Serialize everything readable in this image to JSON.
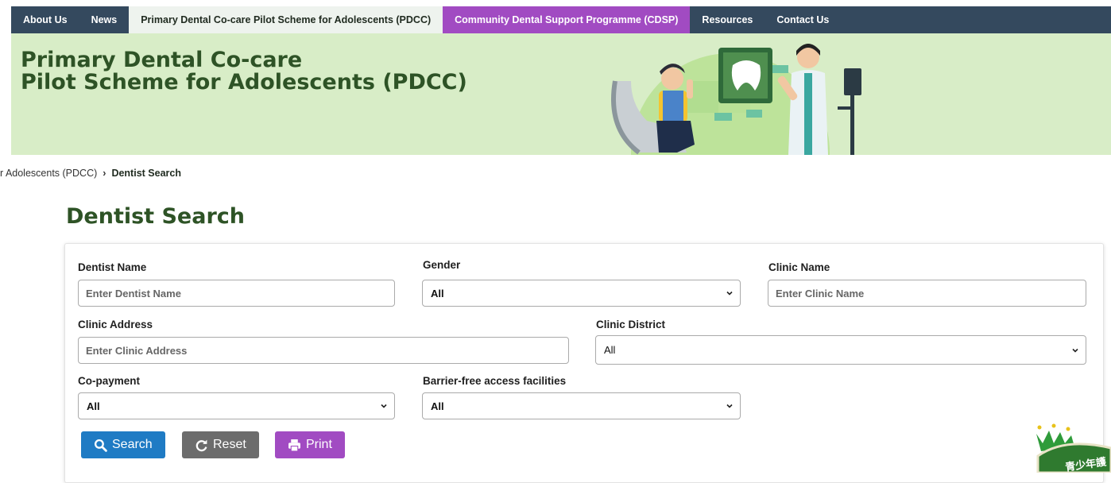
{
  "nav": {
    "items": [
      {
        "label": "About Us"
      },
      {
        "label": "News"
      },
      {
        "label": "Primary Dental Co-care Pilot Scheme for Adolescents (PDCC)"
      },
      {
        "label": "Community Dental Support Programme (CDSP)"
      },
      {
        "label": "Resources"
      },
      {
        "label": "Contact Us"
      }
    ]
  },
  "banner": {
    "title_line1": "Primary Dental Co-care",
    "title_line2": "Pilot Scheme for Adolescents (PDCC)"
  },
  "breadcrumb": {
    "parent": "r Adolescents (PDCC)",
    "separator": "›",
    "current": "Dentist Search"
  },
  "page_title": "Dentist Search",
  "form": {
    "dentist_name": {
      "label": "Dentist Name",
      "placeholder": "Enter Dentist Name"
    },
    "gender": {
      "label": "Gender",
      "value": "All"
    },
    "clinic_name": {
      "label": "Clinic Name",
      "placeholder": "Enter Clinic Name"
    },
    "clinic_address": {
      "label": "Clinic Address",
      "placeholder": "Enter Clinic Address"
    },
    "clinic_district": {
      "label": "Clinic District",
      "value": "All"
    },
    "co_payment": {
      "label": "Co-payment",
      "value": "All"
    },
    "barrier_free": {
      "label": "Barrier-free access facilities",
      "value": "All"
    }
  },
  "buttons": {
    "search": "Search",
    "reset": "Reset",
    "print": "Print"
  },
  "badge": {
    "text": "青少年護"
  },
  "colors": {
    "nav_bg": "#34495e",
    "nav_active_bg": "#eef3ee",
    "cdsp_bg": "#a14bc2",
    "banner_bg": "#d8edc7",
    "title_green": "#2e5326",
    "search_blue": "#1f7bc4",
    "reset_grey": "#6c6c6c",
    "print_purple": "#a14bc2"
  }
}
